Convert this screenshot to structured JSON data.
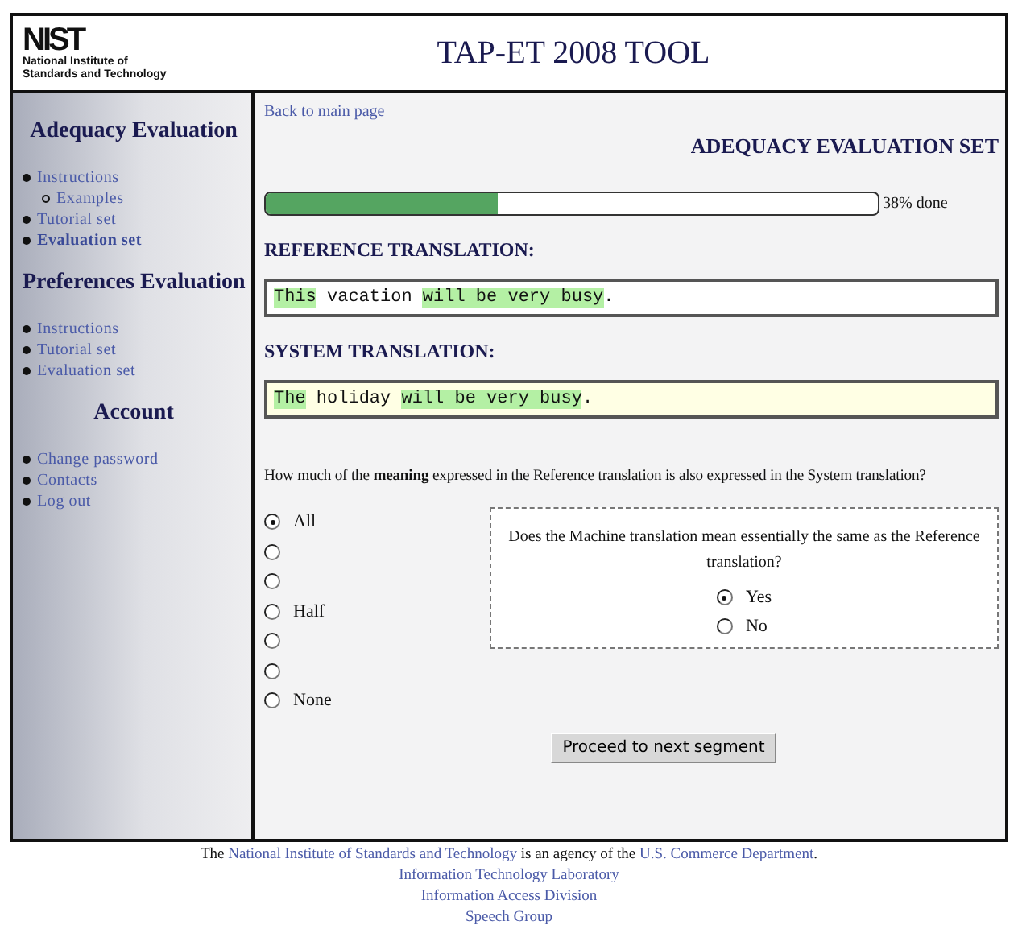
{
  "header": {
    "logo_mark": "NIST",
    "logo_caption": [
      "National Institute of",
      "Standards and Technology"
    ],
    "title": "TAP-ET 2008 TOOL"
  },
  "sidebar": [
    {
      "title": "Adequacy Evaluation",
      "items": [
        {
          "label": "Instructions",
          "selected": false,
          "children": [
            {
              "label": "Examples",
              "selected": false
            }
          ]
        },
        {
          "label": "Tutorial set",
          "selected": false
        },
        {
          "label": "Evaluation set",
          "selected": true
        }
      ]
    },
    {
      "title": "Preferences Evaluation",
      "items": [
        {
          "label": "Instructions",
          "selected": false
        },
        {
          "label": "Tutorial set",
          "selected": false
        },
        {
          "label": "Evaluation set",
          "selected": false
        }
      ]
    },
    {
      "title": "Account",
      "items": [
        {
          "label": "Change password",
          "selected": false
        },
        {
          "label": "Contacts",
          "selected": false
        },
        {
          "label": "Log out",
          "selected": false
        }
      ]
    }
  ],
  "back_link": "Back to main page",
  "set_title": "ADEQUACY EVALUATION SET",
  "progress": {
    "level": 0.38,
    "reading": "38% done"
  },
  "reference": {
    "heading": "REFERENCE TRANSLATION:",
    "segments": [
      {
        "text": "This",
        "highlight": true
      },
      {
        "text": " vacation ",
        "highlight": false
      },
      {
        "text": "will be very busy",
        "highlight": true
      },
      {
        "text": ".",
        "highlight": false
      }
    ]
  },
  "system": {
    "heading": "SYSTEM TRANSLATION:",
    "segments": [
      {
        "text": "The",
        "highlight": true
      },
      {
        "text": " holiday ",
        "highlight": false
      },
      {
        "text": "will be very busy",
        "highlight": true
      },
      {
        "text": ".",
        "highlight": false
      }
    ]
  },
  "question": "How much of the **meaning** expressed in the Reference translation is also expressed in the System translation?",
  "scale": [
    {
      "label": "All",
      "selected": true
    },
    {
      "selected": false
    },
    {
      "selected": false
    },
    {
      "label": "Half",
      "selected": false
    },
    {
      "selected": false
    },
    {
      "selected": false
    },
    {
      "label": "None",
      "selected": false
    }
  ],
  "yes_no": {
    "question": "Does the Machine translation mean essentially the same as the Reference translation?",
    "options": [
      {
        "label": "Yes",
        "selected": true
      },
      {
        "label": "No",
        "selected": false
      }
    ]
  },
  "submit": "Proceed to next segment",
  "footer": {
    "statement": [
      {
        "kind": "text",
        "text": "The "
      },
      {
        "kind": "link",
        "text": "National Institute of Standards and Technology"
      },
      {
        "kind": "text",
        "text": " is an agency of the "
      },
      {
        "kind": "link",
        "text": "U.S. Commerce Department"
      },
      {
        "kind": "text",
        "text": "."
      }
    ],
    "links": [
      "Information Technology Laboratory",
      "Information Access Division",
      "Speech Group"
    ]
  }
}
